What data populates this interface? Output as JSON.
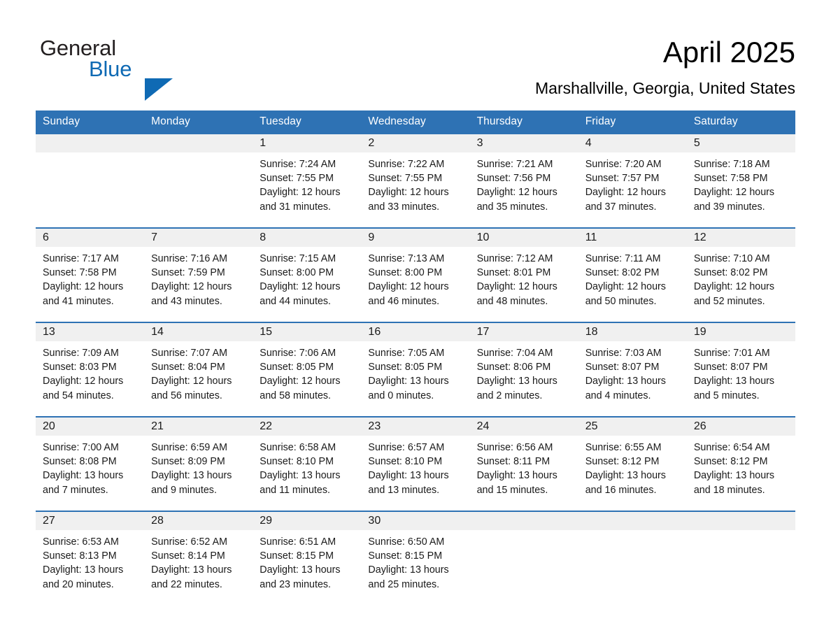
{
  "brand": {
    "name_part1": "General",
    "name_part2": "Blue",
    "accent_color": "#0f6ab4"
  },
  "header": {
    "title": "April 2025",
    "location": "Marshallville, Georgia, United States"
  },
  "theme": {
    "header_blue": "#2e72b4",
    "daynum_band": "#f0f0f0",
    "cell_background": "#ffffff"
  },
  "weekday_headers": [
    "Sunday",
    "Monday",
    "Tuesday",
    "Wednesday",
    "Thursday",
    "Friday",
    "Saturday"
  ],
  "weeks": [
    [
      {
        "day": "",
        "sunrise": "",
        "sunset": "",
        "daylight_l1": "",
        "daylight_l2": ""
      },
      {
        "day": "",
        "sunrise": "",
        "sunset": "",
        "daylight_l1": "",
        "daylight_l2": ""
      },
      {
        "day": "1",
        "sunrise": "Sunrise: 7:24 AM",
        "sunset": "Sunset: 7:55 PM",
        "daylight_l1": "Daylight: 12 hours",
        "daylight_l2": "and 31 minutes."
      },
      {
        "day": "2",
        "sunrise": "Sunrise: 7:22 AM",
        "sunset": "Sunset: 7:55 PM",
        "daylight_l1": "Daylight: 12 hours",
        "daylight_l2": "and 33 minutes."
      },
      {
        "day": "3",
        "sunrise": "Sunrise: 7:21 AM",
        "sunset": "Sunset: 7:56 PM",
        "daylight_l1": "Daylight: 12 hours",
        "daylight_l2": "and 35 minutes."
      },
      {
        "day": "4",
        "sunrise": "Sunrise: 7:20 AM",
        "sunset": "Sunset: 7:57 PM",
        "daylight_l1": "Daylight: 12 hours",
        "daylight_l2": "and 37 minutes."
      },
      {
        "day": "5",
        "sunrise": "Sunrise: 7:18 AM",
        "sunset": "Sunset: 7:58 PM",
        "daylight_l1": "Daylight: 12 hours",
        "daylight_l2": "and 39 minutes."
      }
    ],
    [
      {
        "day": "6",
        "sunrise": "Sunrise: 7:17 AM",
        "sunset": "Sunset: 7:58 PM",
        "daylight_l1": "Daylight: 12 hours",
        "daylight_l2": "and 41 minutes."
      },
      {
        "day": "7",
        "sunrise": "Sunrise: 7:16 AM",
        "sunset": "Sunset: 7:59 PM",
        "daylight_l1": "Daylight: 12 hours",
        "daylight_l2": "and 43 minutes."
      },
      {
        "day": "8",
        "sunrise": "Sunrise: 7:15 AM",
        "sunset": "Sunset: 8:00 PM",
        "daylight_l1": "Daylight: 12 hours",
        "daylight_l2": "and 44 minutes."
      },
      {
        "day": "9",
        "sunrise": "Sunrise: 7:13 AM",
        "sunset": "Sunset: 8:00 PM",
        "daylight_l1": "Daylight: 12 hours",
        "daylight_l2": "and 46 minutes."
      },
      {
        "day": "10",
        "sunrise": "Sunrise: 7:12 AM",
        "sunset": "Sunset: 8:01 PM",
        "daylight_l1": "Daylight: 12 hours",
        "daylight_l2": "and 48 minutes."
      },
      {
        "day": "11",
        "sunrise": "Sunrise: 7:11 AM",
        "sunset": "Sunset: 8:02 PM",
        "daylight_l1": "Daylight: 12 hours",
        "daylight_l2": "and 50 minutes."
      },
      {
        "day": "12",
        "sunrise": "Sunrise: 7:10 AM",
        "sunset": "Sunset: 8:02 PM",
        "daylight_l1": "Daylight: 12 hours",
        "daylight_l2": "and 52 minutes."
      }
    ],
    [
      {
        "day": "13",
        "sunrise": "Sunrise: 7:09 AM",
        "sunset": "Sunset: 8:03 PM",
        "daylight_l1": "Daylight: 12 hours",
        "daylight_l2": "and 54 minutes."
      },
      {
        "day": "14",
        "sunrise": "Sunrise: 7:07 AM",
        "sunset": "Sunset: 8:04 PM",
        "daylight_l1": "Daylight: 12 hours",
        "daylight_l2": "and 56 minutes."
      },
      {
        "day": "15",
        "sunrise": "Sunrise: 7:06 AM",
        "sunset": "Sunset: 8:05 PM",
        "daylight_l1": "Daylight: 12 hours",
        "daylight_l2": "and 58 minutes."
      },
      {
        "day": "16",
        "sunrise": "Sunrise: 7:05 AM",
        "sunset": "Sunset: 8:05 PM",
        "daylight_l1": "Daylight: 13 hours",
        "daylight_l2": "and 0 minutes."
      },
      {
        "day": "17",
        "sunrise": "Sunrise: 7:04 AM",
        "sunset": "Sunset: 8:06 PM",
        "daylight_l1": "Daylight: 13 hours",
        "daylight_l2": "and 2 minutes."
      },
      {
        "day": "18",
        "sunrise": "Sunrise: 7:03 AM",
        "sunset": "Sunset: 8:07 PM",
        "daylight_l1": "Daylight: 13 hours",
        "daylight_l2": "and 4 minutes."
      },
      {
        "day": "19",
        "sunrise": "Sunrise: 7:01 AM",
        "sunset": "Sunset: 8:07 PM",
        "daylight_l1": "Daylight: 13 hours",
        "daylight_l2": "and 5 minutes."
      }
    ],
    [
      {
        "day": "20",
        "sunrise": "Sunrise: 7:00 AM",
        "sunset": "Sunset: 8:08 PM",
        "daylight_l1": "Daylight: 13 hours",
        "daylight_l2": "and 7 minutes."
      },
      {
        "day": "21",
        "sunrise": "Sunrise: 6:59 AM",
        "sunset": "Sunset: 8:09 PM",
        "daylight_l1": "Daylight: 13 hours",
        "daylight_l2": "and 9 minutes."
      },
      {
        "day": "22",
        "sunrise": "Sunrise: 6:58 AM",
        "sunset": "Sunset: 8:10 PM",
        "daylight_l1": "Daylight: 13 hours",
        "daylight_l2": "and 11 minutes."
      },
      {
        "day": "23",
        "sunrise": "Sunrise: 6:57 AM",
        "sunset": "Sunset: 8:10 PM",
        "daylight_l1": "Daylight: 13 hours",
        "daylight_l2": "and 13 minutes."
      },
      {
        "day": "24",
        "sunrise": "Sunrise: 6:56 AM",
        "sunset": "Sunset: 8:11 PM",
        "daylight_l1": "Daylight: 13 hours",
        "daylight_l2": "and 15 minutes."
      },
      {
        "day": "25",
        "sunrise": "Sunrise: 6:55 AM",
        "sunset": "Sunset: 8:12 PM",
        "daylight_l1": "Daylight: 13 hours",
        "daylight_l2": "and 16 minutes."
      },
      {
        "day": "26",
        "sunrise": "Sunrise: 6:54 AM",
        "sunset": "Sunset: 8:12 PM",
        "daylight_l1": "Daylight: 13 hours",
        "daylight_l2": "and 18 minutes."
      }
    ],
    [
      {
        "day": "27",
        "sunrise": "Sunrise: 6:53 AM",
        "sunset": "Sunset: 8:13 PM",
        "daylight_l1": "Daylight: 13 hours",
        "daylight_l2": "and 20 minutes."
      },
      {
        "day": "28",
        "sunrise": "Sunrise: 6:52 AM",
        "sunset": "Sunset: 8:14 PM",
        "daylight_l1": "Daylight: 13 hours",
        "daylight_l2": "and 22 minutes."
      },
      {
        "day": "29",
        "sunrise": "Sunrise: 6:51 AM",
        "sunset": "Sunset: 8:15 PM",
        "daylight_l1": "Daylight: 13 hours",
        "daylight_l2": "and 23 minutes."
      },
      {
        "day": "30",
        "sunrise": "Sunrise: 6:50 AM",
        "sunset": "Sunset: 8:15 PM",
        "daylight_l1": "Daylight: 13 hours",
        "daylight_l2": "and 25 minutes."
      },
      {
        "day": "",
        "sunrise": "",
        "sunset": "",
        "daylight_l1": "",
        "daylight_l2": ""
      },
      {
        "day": "",
        "sunrise": "",
        "sunset": "",
        "daylight_l1": "",
        "daylight_l2": ""
      },
      {
        "day": "",
        "sunrise": "",
        "sunset": "",
        "daylight_l1": "",
        "daylight_l2": ""
      }
    ]
  ]
}
